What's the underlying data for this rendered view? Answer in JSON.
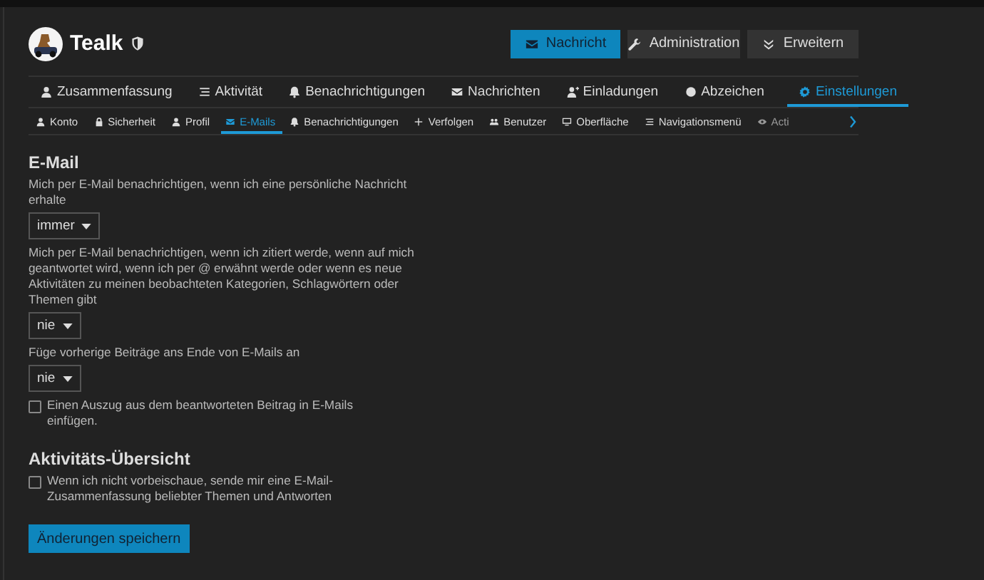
{
  "user": {
    "name": "Tealk"
  },
  "header_buttons": [
    {
      "label": "Nachricht",
      "kind": "primary"
    },
    {
      "label": "Administration",
      "kind": "secondary"
    },
    {
      "label": "Erweitern",
      "kind": "secondary"
    }
  ],
  "main_nav": [
    {
      "label": "Zusammenfassung",
      "selected": false
    },
    {
      "label": "Aktivität",
      "selected": false
    },
    {
      "label": "Benachrichtigungen",
      "selected": false
    },
    {
      "label": "Nachrichten",
      "selected": false
    },
    {
      "label": "Einladungen",
      "selected": false
    },
    {
      "label": "Abzeichen",
      "selected": false
    },
    {
      "label": "Einstellungen",
      "selected": true
    }
  ],
  "sub_nav": [
    {
      "label": "Konto",
      "selected": false
    },
    {
      "label": "Sicherheit",
      "selected": false
    },
    {
      "label": "Profil",
      "selected": false
    },
    {
      "label": "E-Mails",
      "selected": true
    },
    {
      "label": "Benachrichtigungen",
      "selected": false
    },
    {
      "label": "Verfolgen",
      "selected": false
    },
    {
      "label": "Benutzer",
      "selected": false
    },
    {
      "label": "Oberfläche",
      "selected": false
    },
    {
      "label": "Navigationsmenü",
      "selected": false
    },
    {
      "label": "Acti",
      "selected": false
    }
  ],
  "sections": [
    {
      "title": "E-Mail",
      "items": [
        {
          "kind": "select",
          "label": "Mich per E-Mail benachrichtigen, wenn ich eine persönliche Nachricht erhalte",
          "value": "immer"
        },
        {
          "kind": "select",
          "label": "Mich per E-Mail benachrichtigen, wenn ich zitiert werde, wenn auf mich geantwortet wird, wenn ich per @ erwähnt werde oder wenn es neue Aktivitäten zu meinen beobachteten Kategorien, Schlagwörtern oder Themen gibt",
          "value": "nie"
        },
        {
          "kind": "select",
          "label": "Füge vorherige Beiträge ans Ende von E-Mails an",
          "value": "nie"
        },
        {
          "kind": "checkbox",
          "label": "Einen Auszug aus dem beantworteten Beitrag in E-Mails einfügen.",
          "checked": false
        }
      ]
    },
    {
      "title": "Aktivitäts-Übersicht",
      "items": [
        {
          "kind": "checkbox",
          "label": "Wenn ich nicht vorbeischaue, sende mir eine E-Mail-Zusammenfassung beliebter Themen und Antworten",
          "checked": false
        }
      ]
    }
  ],
  "save_button": {
    "label": "Änderungen speichern"
  }
}
